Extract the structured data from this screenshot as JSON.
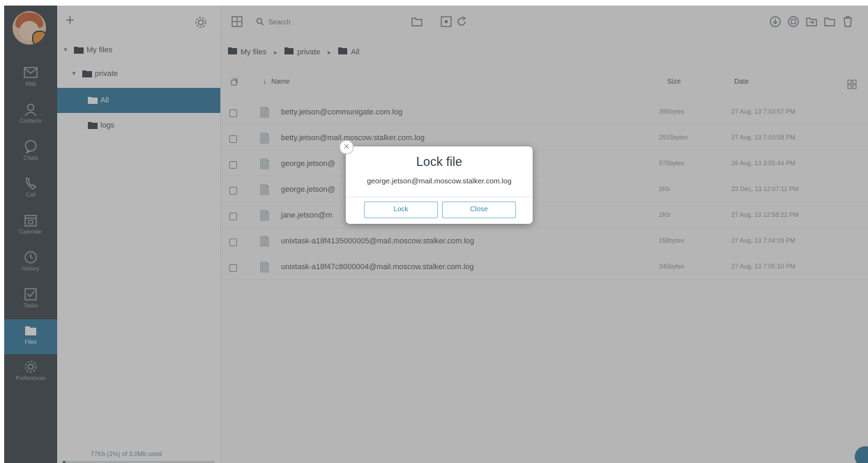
{
  "rail": {
    "items": [
      {
        "label": "Mail",
        "icon": "mail-icon"
      },
      {
        "label": "Contacts",
        "icon": "contacts-icon"
      },
      {
        "label": "Chats",
        "icon": "chat-icon"
      },
      {
        "label": "Call",
        "icon": "phone-icon"
      },
      {
        "label": "Calendar",
        "icon": "calendar-icon"
      },
      {
        "label": "History",
        "icon": "clock-icon"
      },
      {
        "label": "Tasks",
        "icon": "tasks-icon"
      },
      {
        "label": "Files",
        "icon": "files-icon"
      },
      {
        "label": "Preferences",
        "icon": "gear-icon"
      }
    ],
    "active": "Files"
  },
  "tree": {
    "nodes": [
      {
        "label": "My files"
      },
      {
        "label": "private"
      },
      {
        "label": "All"
      },
      {
        "label": "logs"
      }
    ],
    "quota": "77Kb (2%) of 3.0Mb used",
    "quota_fraction": 0.02
  },
  "toolbar": {
    "search_placeholder": "Search"
  },
  "breadcrumb": [
    "My files",
    "private",
    "All"
  ],
  "table": {
    "headers": {
      "name": "Name",
      "size": "Size",
      "date": "Date"
    },
    "rows": [
      {
        "name": "betty.jetson@communigate.com.log",
        "size": "395bytes",
        "date": "27 Aug, 13 7:03:57 PM"
      },
      {
        "name": "betty.jetson@mail.moscow.stalker.com.log",
        "size": "2915bytes",
        "date": "27 Aug, 13 7:03:58 PM"
      },
      {
        "name": "george.jetson@",
        "size": "975bytes",
        "date": "26 Aug, 13 3:55:44 PM"
      },
      {
        "name": "george.jetson@",
        "size": "2Kb",
        "date": "23 Dec, 13 12:07:11 PM"
      },
      {
        "name": "jane.jetson@m",
        "size": "2Kb",
        "date": "27 Aug, 13 12:58:22 PM"
      },
      {
        "name": "unixtask-a18f4135000005@mail.moscow.stalker.com.log",
        "size": "158bytes",
        "date": "27 Aug, 13 7:04:09 PM"
      },
      {
        "name": "unixtask-a18f47c8000004@mail.moscow.stalker.com.log",
        "size": "345bytes",
        "date": "27 Aug, 13 7:05:10 PM"
      }
    ]
  },
  "modal": {
    "title": "Lock file",
    "message": "george.jetson@mail.moscow.stalker.com.log",
    "lock_label": "Lock",
    "close_label": "Close"
  },
  "colors": {
    "rail_bg": "#333b44",
    "accent": "#26749a",
    "overlay": "rgba(85,85,85,0.42)"
  }
}
